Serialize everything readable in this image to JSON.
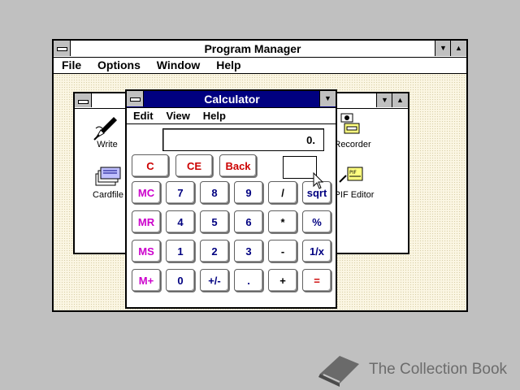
{
  "program_manager": {
    "title": "Program Manager",
    "menu": [
      "File",
      "Options",
      "Window",
      "Help"
    ]
  },
  "group": {
    "icons": [
      {
        "label": "Write",
        "icon": "write-icon"
      },
      {
        "label": "Cardfile",
        "icon": "cardfile-icon"
      },
      {
        "label": "Recorder",
        "icon": "recorder-icon"
      },
      {
        "label": "PIF Editor",
        "icon": "pif-editor-icon"
      }
    ]
  },
  "calculator": {
    "title": "Calculator",
    "menu": [
      "Edit",
      "View",
      "Help"
    ],
    "display": "0.",
    "top_keys": [
      "C",
      "CE",
      "Back"
    ],
    "memory_keys": [
      "MC",
      "MR",
      "MS",
      "M+"
    ],
    "rows": [
      [
        "7",
        "8",
        "9",
        "/",
        "sqrt"
      ],
      [
        "4",
        "5",
        "6",
        "*",
        "%"
      ],
      [
        "1",
        "2",
        "3",
        "-",
        "1/x"
      ],
      [
        "0",
        "+/-",
        ".",
        "+",
        "="
      ]
    ]
  },
  "watermark": {
    "text": "The Collection Book"
  },
  "colors": {
    "desktop": "#c0c0c0",
    "title_active": "#000080",
    "key_red": "#cc0000",
    "key_magenta": "#cc00cc",
    "key_blue": "#000080"
  }
}
